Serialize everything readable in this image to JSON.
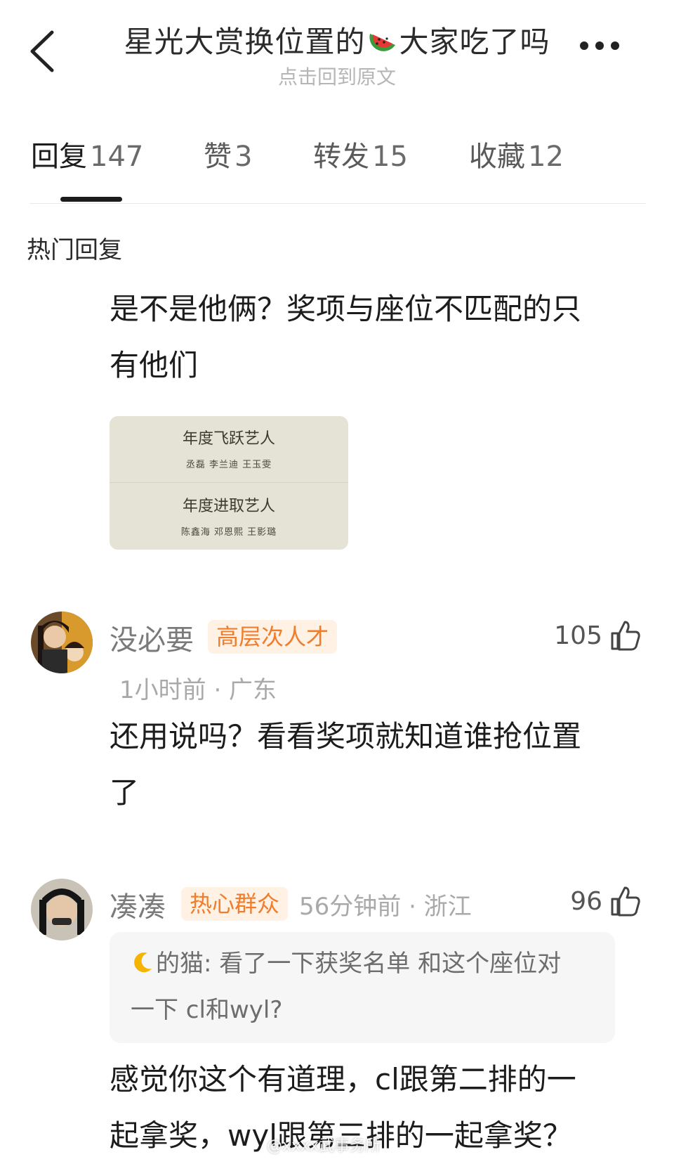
{
  "header": {
    "title_prefix": "星光大赏换位置的",
    "title_suffix": "大家吃了吗",
    "subtitle": "点击回到原文"
  },
  "tabs": [
    {
      "label": "回复",
      "count": "147",
      "active": true
    },
    {
      "label": "赞",
      "count": "3",
      "active": false
    },
    {
      "label": "转发",
      "count": "15",
      "active": false
    },
    {
      "label": "收藏",
      "count": "12",
      "active": false
    }
  ],
  "section_title": "热门回复",
  "top_comment": {
    "text_line1": "是不是他俩？奖项与座位不匹配的只",
    "text_line2": "有他们",
    "image": {
      "award1": "年度飞跃艺人",
      "names1": "丞磊  李兰迪  王玉雯",
      "award2": "年度进取艺人",
      "names2": "陈鑫海  邓恩熙  王影璐"
    }
  },
  "comments": [
    {
      "user": "没必要",
      "badge": "高层次人才",
      "meta": "1小时前 · 广东",
      "likes": "105",
      "text_line1": "还用说吗？看看奖项就知道谁抢位置",
      "text_line2": "了"
    },
    {
      "user": "凑凑",
      "badge": "热心群众",
      "meta": "56分钟前 · 浙江",
      "likes": "96",
      "quote_line1": "的猫: 看了一下获奖名单 和这个座位对",
      "quote_line2": "一下 cl和wyl?",
      "text_line1": "感觉你这个有道理，cl跟第二排的一",
      "text_line2": "起拿奖，wyl跟第三排的一起拿奖？"
    }
  ],
  "watermark": "@xxxx武事务所",
  "colors": {
    "badge_text": "#f07d2c",
    "badge_bg": "#fff1e4",
    "meta_gray": "#a9a9a9",
    "card_bg": "#e5e2d6"
  }
}
